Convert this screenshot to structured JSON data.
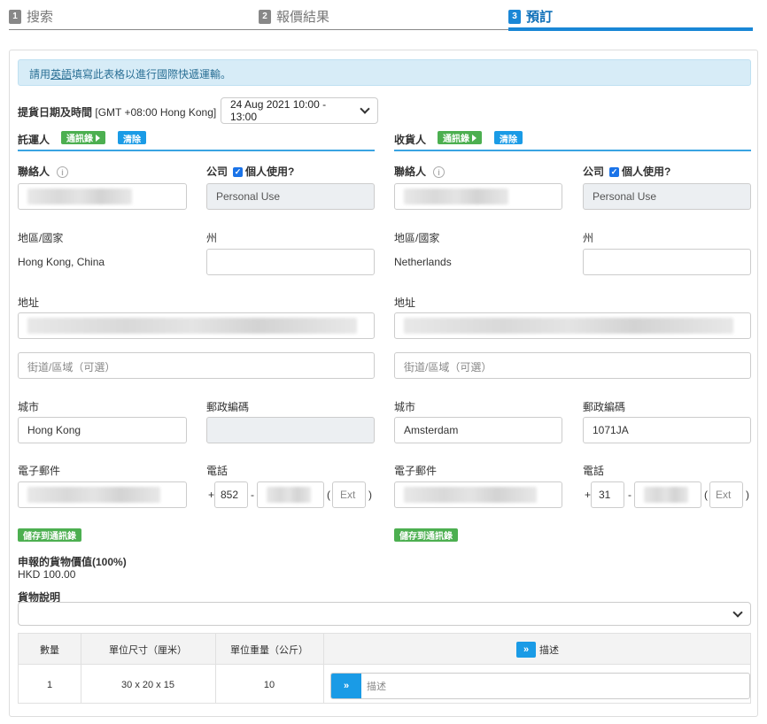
{
  "steps": [
    {
      "num": "1",
      "label": "搜索"
    },
    {
      "num": "2",
      "label": "報價結果"
    },
    {
      "num": "3",
      "label": "預訂"
    }
  ],
  "notice": {
    "before": "請用",
    "link": "英語",
    "after": "填寫此表格以進行國際快遞運輸。"
  },
  "pickup": {
    "label": "提貨日期及時間",
    "tz": "[GMT +08:00 Hong Kong]",
    "value": "24 Aug 2021 10:00 - 13:00"
  },
  "common": {
    "address_book": "通訊錄",
    "clear": "清除",
    "contact": "聯絡人",
    "company": "公司",
    "personal_use_q": "個人使用?",
    "personal_use": "Personal Use",
    "region": "地區/國家",
    "state": "州",
    "address": "地址",
    "street_placeholder": "街道/區域（可選）",
    "city": "城市",
    "postal": "郵政編碼",
    "email": "電子郵件",
    "phone": "電話",
    "ext": "Ext",
    "save_book": "儲存到通訊錄",
    "plus": "+",
    "dash": "-",
    "lparen": "(",
    "rparen": ")",
    "check": "✓",
    "info": "i"
  },
  "shipper": {
    "title": "託運人",
    "region": "Hong Kong, China",
    "city": "Hong Kong",
    "postal": "",
    "phone_code": "852"
  },
  "receiver": {
    "title": "收貨人",
    "region": "Netherlands",
    "city": "Amsterdam",
    "postal": "1071JA",
    "phone_code": "31"
  },
  "declared": {
    "label": "申報的貨物價值(100%)",
    "value": "HKD 100.00"
  },
  "goods_desc": {
    "label": "貨物說明",
    "value": ""
  },
  "table": {
    "headers": [
      "數量",
      "單位尺寸（厘米）",
      "單位重量（公斤）",
      "描述"
    ],
    "rows": [
      {
        "qty": "1",
        "size": "30 x 20 x 15",
        "weight": "10",
        "desc_placeholder": "描述"
      }
    ]
  },
  "icons": {
    "expand": "chevron-double-down-icon",
    "go": "chevron-double-right-icon"
  },
  "colors": {
    "accent": "#1a87d6",
    "green": "#4caf50",
    "notice_bg": "#d7ecf7"
  }
}
